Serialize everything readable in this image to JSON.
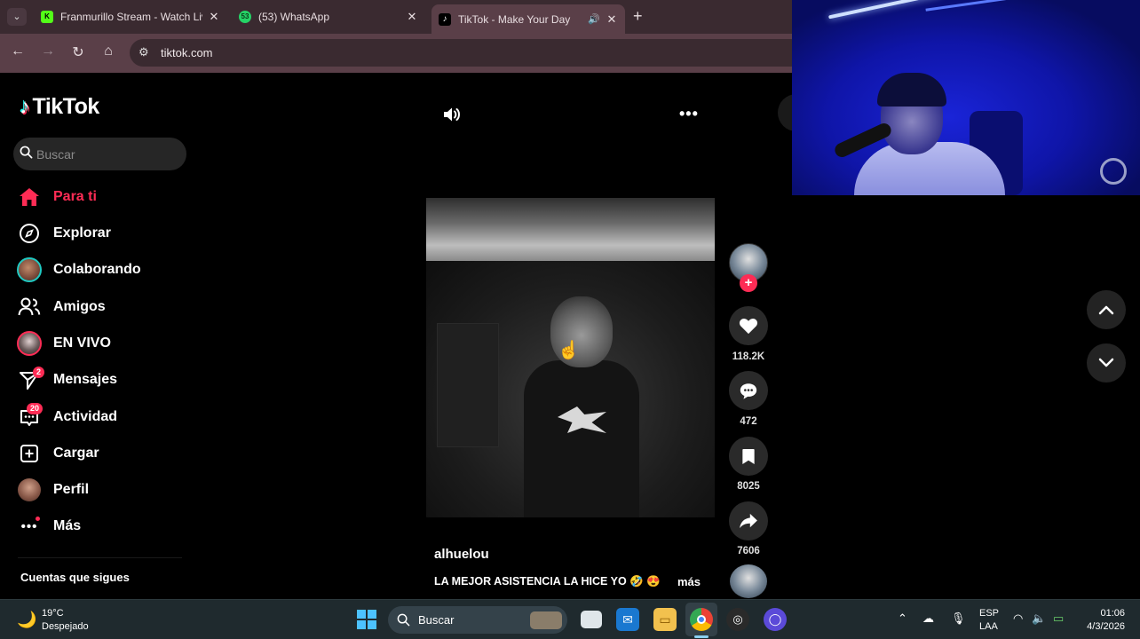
{
  "browser": {
    "tabs": [
      {
        "title": "Franmurillo Stream - Watch Liv",
        "favicon_color": "#53fc18",
        "favicon_text": "K"
      },
      {
        "title": "(53) WhatsApp",
        "favicon_color": "#25d366",
        "favicon_text": "53"
      },
      {
        "title": "TikTok - Make Your Day",
        "favicon_color": "#000000",
        "favicon_text": "♪",
        "active": true
      }
    ],
    "new_tab_label": "+",
    "url": "tiktok.com"
  },
  "tiktok": {
    "logo_text": "TikTok",
    "search_placeholder": "Buscar",
    "nav": [
      {
        "label": "Para ti",
        "icon": "home-icon",
        "active": true
      },
      {
        "label": "Explorar",
        "icon": "compass-icon"
      },
      {
        "label": "Colaborando",
        "icon": "avatar-icon"
      },
      {
        "label": "Amigos",
        "icon": "friends-icon"
      },
      {
        "label": "EN VIVO",
        "icon": "live-avatar-icon"
      },
      {
        "label": "Mensajes",
        "icon": "messages-icon",
        "badge": "2"
      },
      {
        "label": "Actividad",
        "icon": "activity-icon",
        "badge": "20"
      },
      {
        "label": "Cargar",
        "icon": "upload-icon"
      },
      {
        "label": "Perfil",
        "icon": "profile-avatar-icon"
      },
      {
        "label": "Más",
        "icon": "more-icon"
      }
    ],
    "following_title": "Cuentas que sigues",
    "video": {
      "author": "alhuelou",
      "caption": "LA MEJOR ASISTENCIA LA HICE YO 🤣 😍",
      "more_label": "más",
      "more_dots": "•••",
      "likes": "118.2K",
      "comments": "472",
      "saves": "8025",
      "shares": "7606"
    }
  },
  "taskbar": {
    "weather_temp": "19°C",
    "weather_desc": "Despejado",
    "search_label": "Buscar",
    "lang_line1": "ESP",
    "lang_line2": "LAA",
    "time": "01:06",
    "date": "4/3/2026"
  },
  "colors": {
    "tiktok_accent": "#fe2c55",
    "teal": "#25f4ee",
    "chrome_tab_bg": "#3a2a30",
    "chrome_toolbar": "#5a3f48",
    "taskbar_bg": "#1f2a2e"
  }
}
